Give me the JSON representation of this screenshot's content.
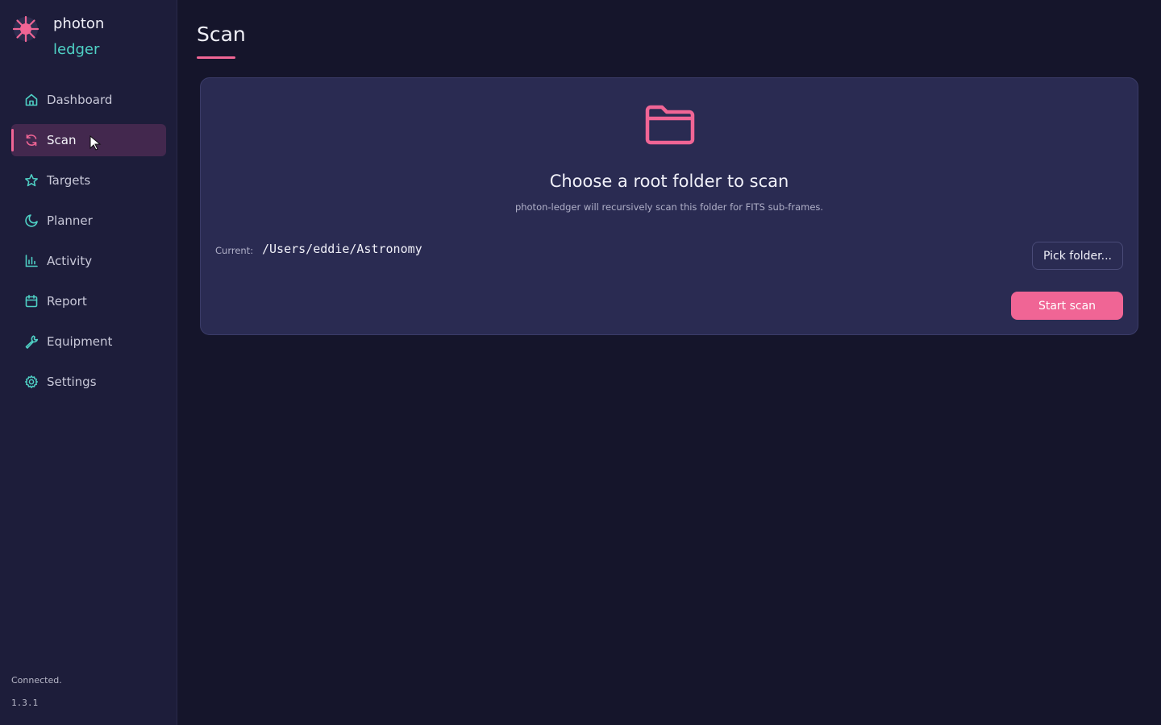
{
  "brand": {
    "line1": "photon",
    "line2": "ledger",
    "logo_icon": "star-burst-icon",
    "accent": "#f06595",
    "secondary": "#4fd1c5"
  },
  "sidebar": {
    "items": [
      {
        "label": "Dashboard",
        "icon": "home-icon",
        "active": false
      },
      {
        "label": "Scan",
        "icon": "refresh-icon",
        "active": true
      },
      {
        "label": "Targets",
        "icon": "star-icon",
        "active": false
      },
      {
        "label": "Planner",
        "icon": "moon-icon",
        "active": false
      },
      {
        "label": "Activity",
        "icon": "bar-chart-icon",
        "active": false
      },
      {
        "label": "Report",
        "icon": "calendar-icon",
        "active": false
      },
      {
        "label": "Equipment",
        "icon": "wrench-icon",
        "active": false
      },
      {
        "label": "Settings",
        "icon": "gear-icon",
        "active": false
      }
    ],
    "status": "Connected.",
    "version": "1.3.1"
  },
  "main": {
    "title": "Scan",
    "card": {
      "icon": "folder-icon",
      "title": "Choose a root folder to scan",
      "subtitle": "photon-ledger will recursively scan this folder for FITS sub-frames.",
      "current_label": "Current:",
      "current_path": "/Users/eddie/Astronomy",
      "pick_label": "Pick folder...",
      "start_label": "Start scan"
    }
  }
}
